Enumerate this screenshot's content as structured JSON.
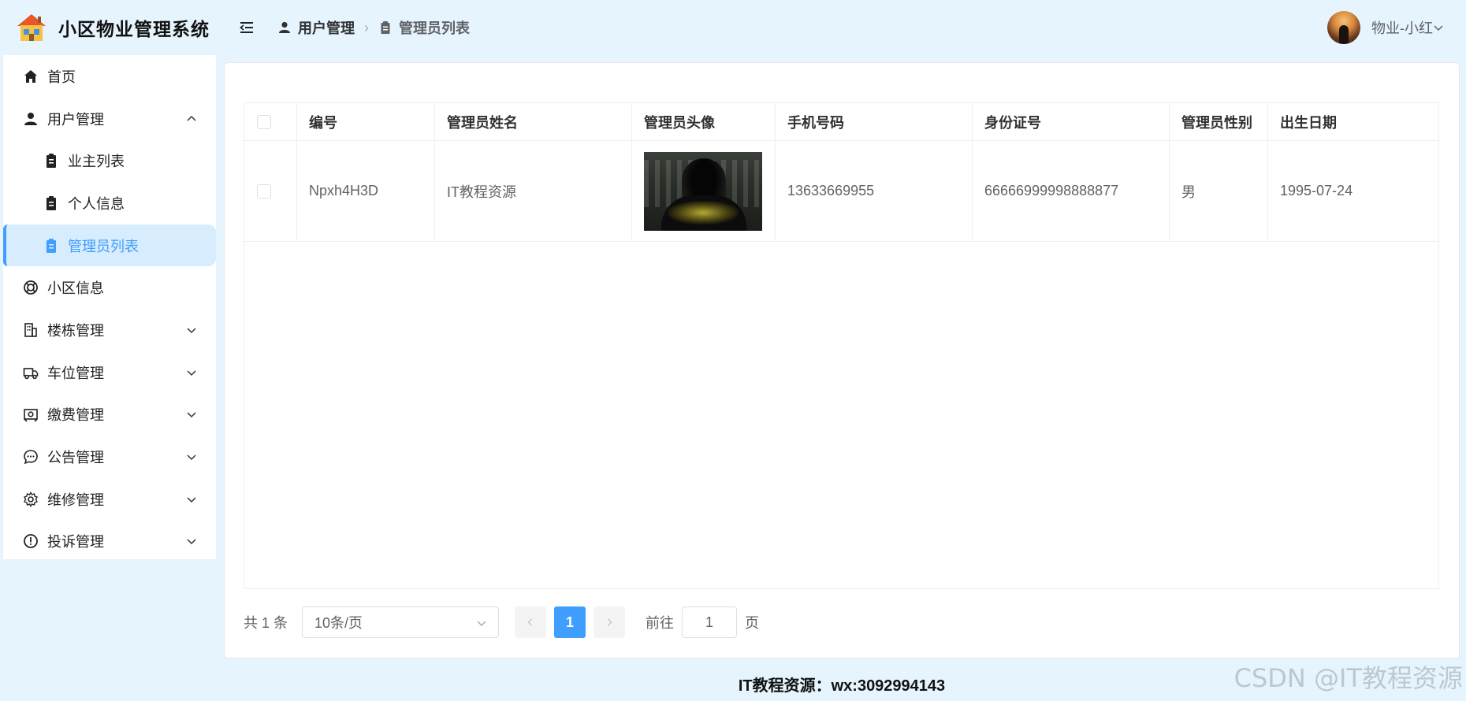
{
  "app": {
    "title": "小区物业管理系统"
  },
  "sidebar": {
    "items": [
      {
        "label": "首页",
        "icon": "home-icon"
      },
      {
        "label": "用户管理",
        "icon": "user-icon",
        "expanded": true
      },
      {
        "label": "业主列表",
        "icon": "clipboard-icon"
      },
      {
        "label": "个人信息",
        "icon": "clipboard-icon"
      },
      {
        "label": "管理员列表",
        "icon": "clipboard-icon",
        "active": true
      },
      {
        "label": "小区信息",
        "icon": "lifebuoy-icon"
      },
      {
        "label": "楼栋管理",
        "icon": "building-icon"
      },
      {
        "label": "车位管理",
        "icon": "truck-icon"
      },
      {
        "label": "缴费管理",
        "icon": "wallet-icon"
      },
      {
        "label": "公告管理",
        "icon": "chat-icon"
      },
      {
        "label": "维修管理",
        "icon": "gear-icon"
      },
      {
        "label": "投诉管理",
        "icon": "warning-icon"
      }
    ]
  },
  "header": {
    "breadcrumb": [
      "用户管理",
      "管理员列表"
    ],
    "user_name": "物业-小红"
  },
  "table": {
    "columns": [
      "编号",
      "管理员姓名",
      "管理员头像",
      "手机号码",
      "身份证号",
      "管理员性别",
      "出生日期"
    ],
    "rows": [
      {
        "id": "Npxh4H3D",
        "name": "IT教程资源",
        "avatar": "hooded-figure-photo",
        "phone": "13633669955",
        "id_card": "66666999998888877",
        "gender": "男",
        "birth": "1995-07-24"
      }
    ]
  },
  "pagination": {
    "total_text": "共 1 条",
    "page_size": "10条/页",
    "current_page": "1",
    "goto_label": "前往",
    "goto_value": "1",
    "page_suffix": "页"
  },
  "footer": {
    "text": "IT教程资源：wx:3092994143"
  },
  "watermark": "CSDN @IT教程资源",
  "colors": {
    "accent": "#409eff",
    "background": "#e6f4fd",
    "active_bg": "#d7ecfd"
  }
}
